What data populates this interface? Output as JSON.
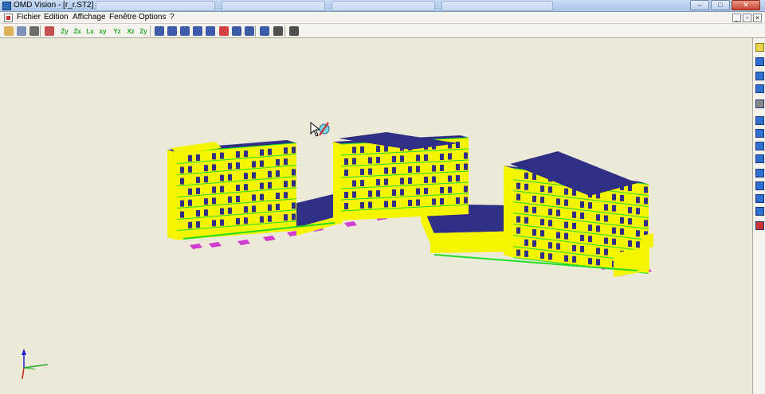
{
  "window": {
    "title": "OMD Vision - [r_r.ST2]",
    "controls": {
      "minimize": "–",
      "maximize": "□",
      "close": "✕"
    }
  },
  "menubar": {
    "items": [
      "Fichier",
      "Edition",
      "Affichage",
      "Fenêtre",
      "Options",
      "?"
    ],
    "mdi_controls": {
      "minimize": "_",
      "restore": "▫",
      "close": "×"
    }
  },
  "toolbar": {
    "buttons": [
      {
        "name": "open-icon",
        "glyph": ""
      },
      {
        "name": "copy-icon",
        "glyph": ""
      },
      {
        "name": "print-icon",
        "glyph": ""
      },
      {
        "name": "grid-icon",
        "glyph": ""
      },
      {
        "name": "view-zy-icon",
        "glyph": "Zy"
      },
      {
        "name": "view-zx-icon",
        "glyph": "Zx"
      },
      {
        "name": "view-xz-icon",
        "glyph": "Lx"
      },
      {
        "name": "view-xy-icon",
        "glyph": "xy"
      },
      {
        "name": "view-yz-icon",
        "glyph": "Yz"
      },
      {
        "name": "view-xzz-icon",
        "glyph": "Xz"
      },
      {
        "name": "view-3d-icon",
        "glyph": "Zy"
      },
      {
        "name": "zoom-window-icon",
        "glyph": ""
      },
      {
        "name": "zoom-all-icon",
        "glyph": ""
      },
      {
        "name": "zoom-out-icon",
        "glyph": ""
      },
      {
        "name": "zoom-in-icon",
        "glyph": ""
      },
      {
        "name": "fit-icon",
        "glyph": ""
      },
      {
        "name": "rotate-icon",
        "glyph": ""
      },
      {
        "name": "eye-icon",
        "glyph": ""
      },
      {
        "name": "pan-icon",
        "glyph": ""
      },
      {
        "name": "render-icon",
        "glyph": ""
      },
      {
        "name": "print-preview-icon",
        "glyph": ""
      },
      {
        "name": "binoculars-icon",
        "glyph": ""
      }
    ]
  },
  "sidetoolbar": {
    "buttons": [
      "layers-icon",
      "nodes-icon",
      "cube-icon",
      "columns-icon",
      "mesh-icon",
      "beam-icon",
      "slab-icon",
      "wall-icon",
      "panel-icon",
      "column-icon",
      "load-icon",
      "support-icon",
      "result-icon",
      "check-icon"
    ]
  },
  "colors": {
    "wall": "#f5f500",
    "roof": "#2f2f86",
    "edge_green": "#22dd22",
    "footing": "#d23bd2",
    "background": "#ece9d8",
    "axis_x": "#22aa22",
    "axis_y": "#2222cc",
    "axis_z": "#cc2222"
  }
}
